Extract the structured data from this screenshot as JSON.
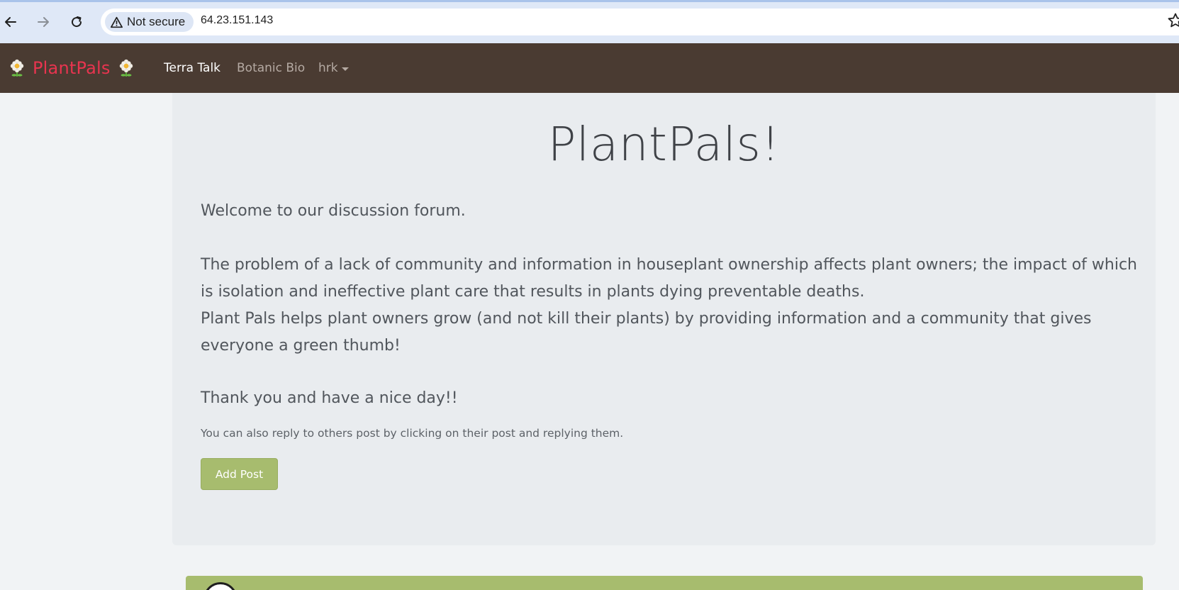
{
  "browser": {
    "security_label": "Not secure",
    "url": "64.23.151.143"
  },
  "navbar": {
    "brand": "PlantPals",
    "links": {
      "terra_talk": "Terra Talk",
      "botanic_bio": "Botanic Bio",
      "user": "hrk"
    }
  },
  "main": {
    "title": "PlantPals!",
    "welcome": "Welcome to our discussion forum.",
    "problem_line1": "The problem of a lack of community and information in houseplant ownership affects plant owners; the impact of which is isolation and ineffective plant care that results in plants dying preventable deaths.",
    "problem_line2": "Plant Pals helps plant owners grow (and not kill their plants) by providing information and a community that gives everyone a green thumb!",
    "thanks": "Thank you and have a nice day!!",
    "note": "You can also reply to others post by clicking on their post and replying them.",
    "add_post_label": "Add Post"
  },
  "colors": {
    "navbar_bg": "#4a3b32",
    "brand": "#e8344f",
    "accent_green": "#a7bc6e",
    "jumbotron_bg": "#e9ecef"
  },
  "icons": {
    "back": "arrow-left-icon",
    "forward": "arrow-right-icon",
    "reload": "reload-icon",
    "warning": "warning-triangle-icon",
    "bookmark": "star-icon",
    "brand": "daisy-flower-icon"
  }
}
